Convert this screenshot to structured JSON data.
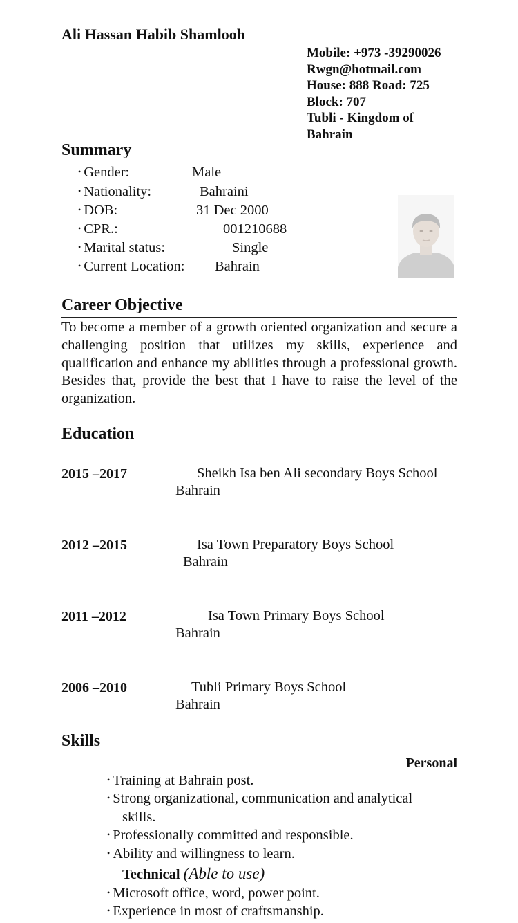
{
  "header": {
    "name": "Ali Hassan Habib Shamlooh",
    "contact": [
      "Mobile: +973 -39290026",
      "Rwgn@hotmail.com",
      "House: 888 Road: 725",
      "Block: 707",
      "Tubli - Kingdom of",
      "Bahrain"
    ]
  },
  "summary": {
    "heading": "Summary",
    "rows": [
      {
        "label": "Gender:",
        "value": "Male"
      },
      {
        "label": "Nationality:",
        "value": "Bahraini"
      },
      {
        "label": "DOB:",
        "value": "31 Dec 2000"
      },
      {
        "label": "CPR.:",
        "value": "001210688"
      },
      {
        "label": "Marital status:",
        "value": "Single"
      },
      {
        "label": "Current Location:",
        "value": "Bahrain"
      }
    ]
  },
  "objective": {
    "heading": "Career Objective",
    "text": "To become a member of a growth oriented organization and secure a challenging position that utilizes my skills, experience and qualification and enhance my abilities through a professional growth. Besides that, provide the best that I have to raise the level of the organization."
  },
  "education": {
    "heading": "Education",
    "entries": [
      {
        "years": "2015 –2017",
        "school": "Sheikh Isa ben Ali secondary Boys School",
        "place": "Bahrain"
      },
      {
        "years": "2012 –2015",
        "school": "Isa Town Preparatory Boys School",
        "place": "Bahrain"
      },
      {
        "years": "2011 –2012",
        "school": "Isa Town Primary Boys School",
        "place": "Bahrain"
      },
      {
        "years": "2006 –2010",
        "school": "Tubli Primary Boys School",
        "place": "Bahrain"
      }
    ]
  },
  "skills": {
    "heading": "Skills",
    "personal_label": "Personal",
    "personal": [
      "Training at Bahrain post.",
      "Strong organizational, communication and analytical",
      "skills.",
      "Professionally committed and responsible.",
      "Ability and willingness to learn."
    ],
    "technical_label": "Technical",
    "technical_note": "(Able to use)",
    "technical": [
      "Microsoft office, word, power point.",
      "Experience in most of craftsmanship."
    ]
  }
}
